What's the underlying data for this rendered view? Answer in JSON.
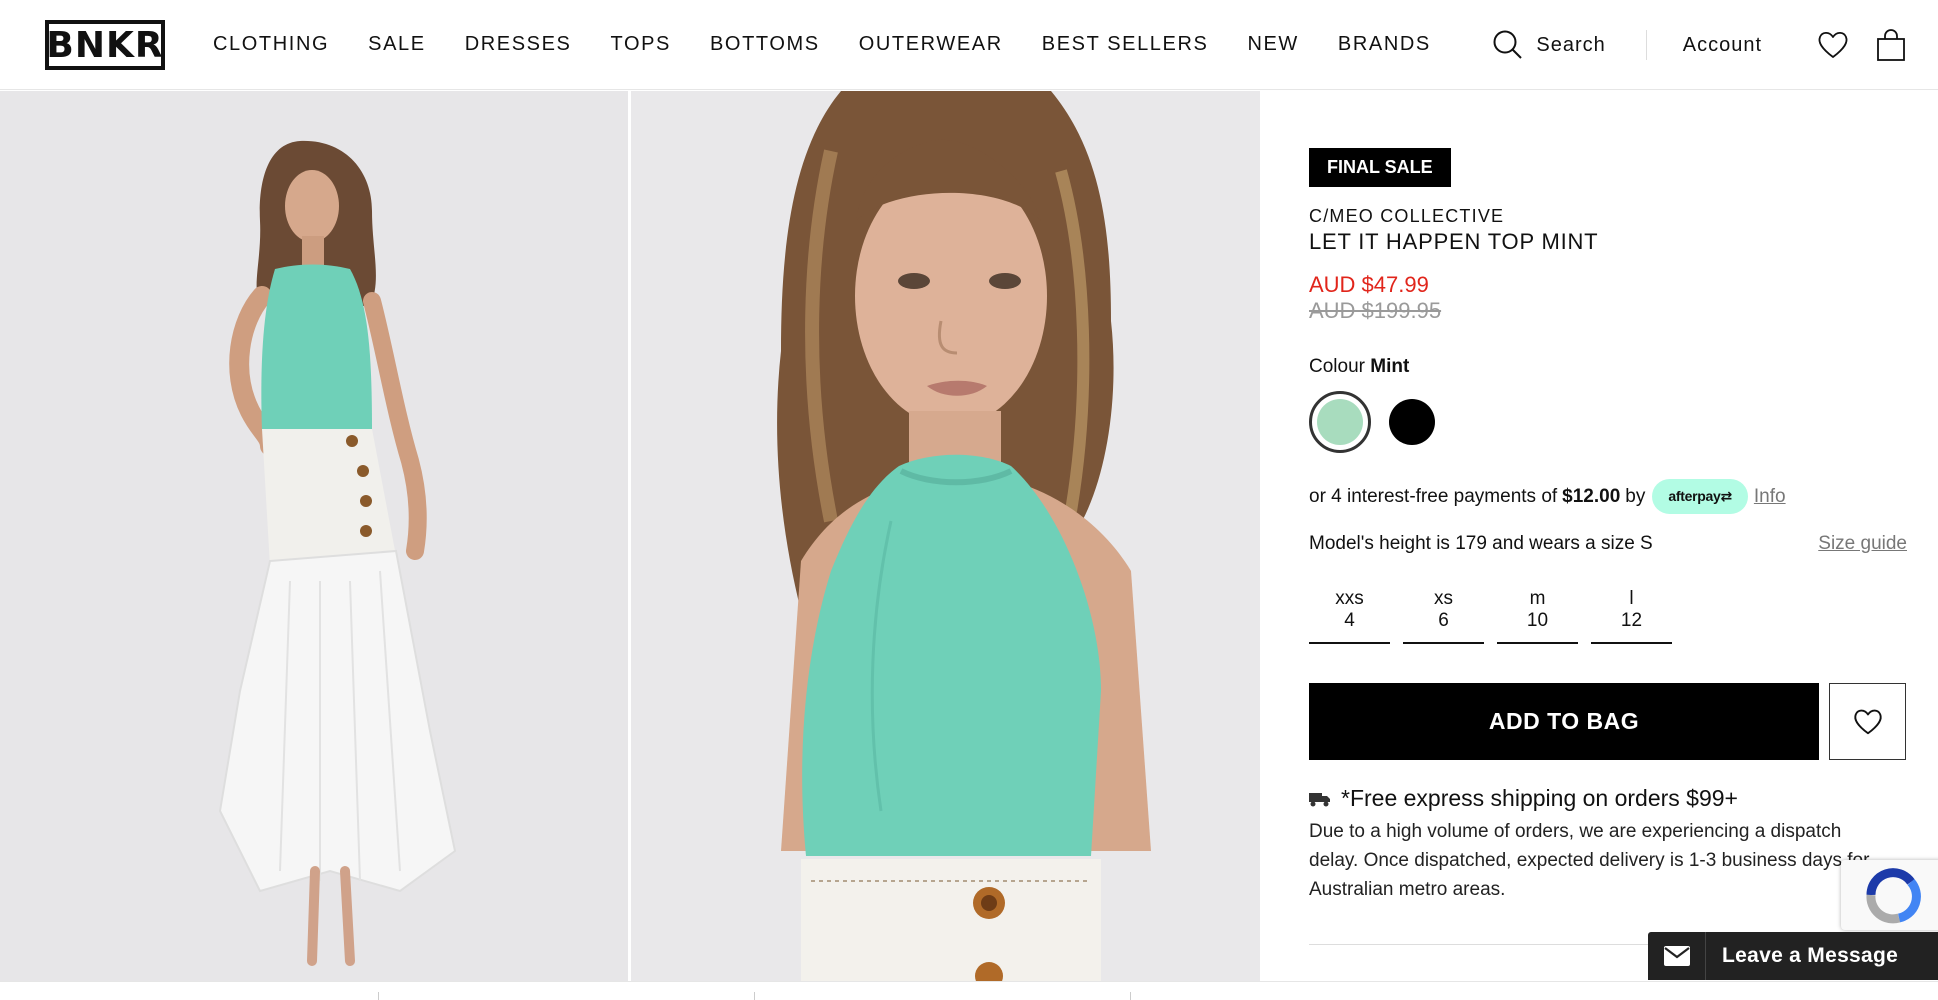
{
  "header": {
    "logo": "BNKR",
    "nav": [
      "CLOTHING",
      "SALE",
      "DRESSES",
      "TOPS",
      "BOTTOMS",
      "OUTERWEAR",
      "BEST SELLERS",
      "NEW",
      "BRANDS"
    ],
    "search_label": "Search",
    "account_label": "Account",
    "icons": [
      "search-icon",
      "heart-icon",
      "bag-icon"
    ]
  },
  "product": {
    "badge": "FINAL SALE",
    "brand": "C/MEO COLLECTIVE",
    "name": "LET IT HAPPEN TOP MINT",
    "price_now": "AUD $47.99",
    "price_was": "AUD $199.95",
    "colour_label": "Colour",
    "colour_selected": "Mint",
    "swatch_colors": [
      "#a8dcbe",
      "#000000"
    ],
    "afterpay": {
      "prefix": "or 4 interest-free payments of",
      "amount": "$12.00",
      "by": "by",
      "badge": "afterpay",
      "info": "Info"
    },
    "model_info": "Model's height is 179 and wears a size S",
    "size_guide": "Size guide",
    "sizes": [
      {
        "label": "xxs",
        "num": "4"
      },
      {
        "label": "xs",
        "num": "6"
      },
      {
        "label": "m",
        "num": "10"
      },
      {
        "label": "l",
        "num": "12"
      }
    ],
    "add_to_bag": "ADD TO BAG",
    "shipping_title": "*Free express shipping on orders $99+",
    "shipping_text": "Due to a high volume of orders, we are experiencing a dispatch delay. Once dispatched, expected delivery is 1-3 business days for Australian metro areas."
  },
  "chat": {
    "label": "Leave a Message"
  }
}
